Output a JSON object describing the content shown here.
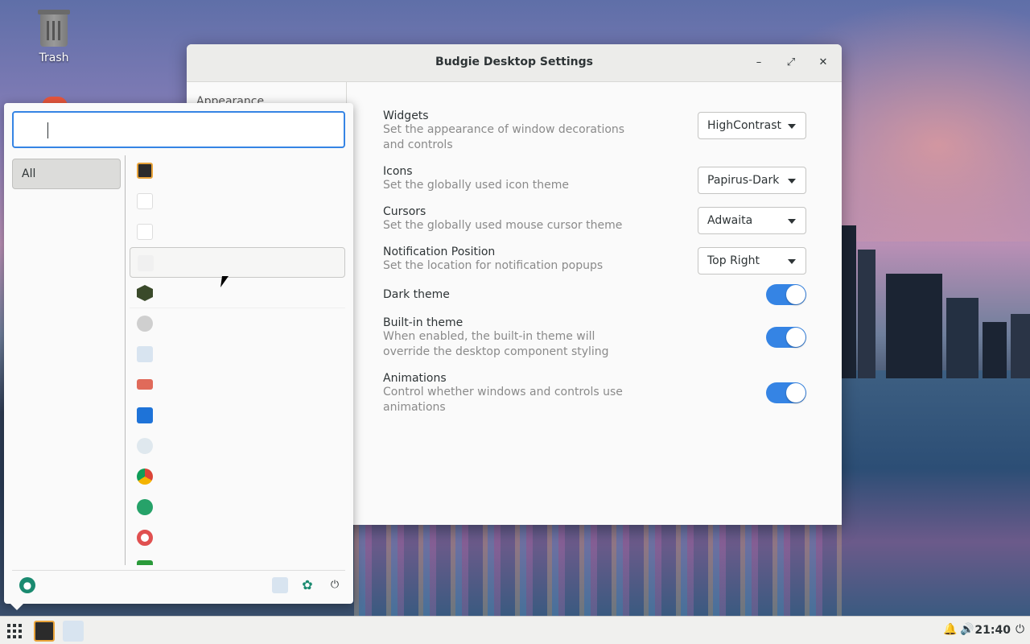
{
  "desktop": {
    "trash_label": "Trash"
  },
  "settings_window": {
    "title": "Budgie Desktop Settings",
    "minimize": "–",
    "maximize": "⤢",
    "close": "✕",
    "sidebar": {
      "items": [
        {
          "label": "Appearance"
        }
      ]
    },
    "rows": [
      {
        "name": "Widgets",
        "desc": "Set the appearance of window decorations and controls",
        "control": "dropdown",
        "value": "HighContrast"
      },
      {
        "name": "Icons",
        "desc": "Set the globally used icon theme",
        "control": "dropdown",
        "value": "Papirus-Dark"
      },
      {
        "name": "Cursors",
        "desc": "Set the globally used mouse cursor theme",
        "control": "dropdown",
        "value": "Adwaita"
      },
      {
        "name": "Notification Position",
        "desc": "Set the location for notification popups",
        "control": "dropdown",
        "value": "Top Right"
      },
      {
        "name": "Dark theme",
        "desc": "",
        "control": "toggle",
        "value": true
      },
      {
        "name": "Built-in theme",
        "desc": "When enabled, the built-in theme will override the desktop component styling",
        "control": "toggle",
        "value": true
      },
      {
        "name": "Animations",
        "desc": "Control whether windows and controls use animations",
        "control": "toggle",
        "value": true
      }
    ]
  },
  "app_menu": {
    "search": {
      "value": "",
      "placeholder": ""
    },
    "categories": [
      {
        "label": "All"
      }
    ],
    "apps": [
      {
        "icon": "terminal-icon",
        "color": "#2b2b2b"
      },
      {
        "icon": "blank-app-icon",
        "color": "#e8e8e8"
      },
      {
        "icon": "blank-app-icon",
        "color": "#e8e8e8"
      },
      {
        "icon": "blank-app-icon",
        "color": "#f0f0f0"
      },
      {
        "icon": "betacraft-icon",
        "color": "#3a4a2a"
      },
      {
        "icon": "settings-gear-icon",
        "color": "#cfcfcf"
      },
      {
        "icon": "system-monitor-icon",
        "color": "#d8e4f0"
      },
      {
        "icon": "camera-icon",
        "color": "#e06a5a"
      },
      {
        "icon": "files-folder-icon",
        "color": "#1e73d8"
      },
      {
        "icon": "dolphin-icon",
        "color": "#dfe8ee"
      },
      {
        "icon": "chrome-icon",
        "color": "#4a8cf0"
      },
      {
        "icon": "maps-icon",
        "color": "#26a269"
      },
      {
        "icon": "help-lifebuoy-icon",
        "color": "#e05050"
      },
      {
        "icon": "spreadsheet-icon",
        "color": "#2a9a3a"
      }
    ],
    "footer": {
      "user_icon": "user-account-icon",
      "monitor_icon": "system-monitor-icon",
      "settings_icon": "settings-icon",
      "power_icon": "power-icon"
    }
  },
  "panel": {
    "clock": "21:40",
    "tray": {
      "bell": "🔔",
      "volume": "🔊",
      "power": "⏻"
    }
  },
  "colors": {
    "accent": "#3584e4",
    "panel_bg": "#f0f0ee"
  }
}
